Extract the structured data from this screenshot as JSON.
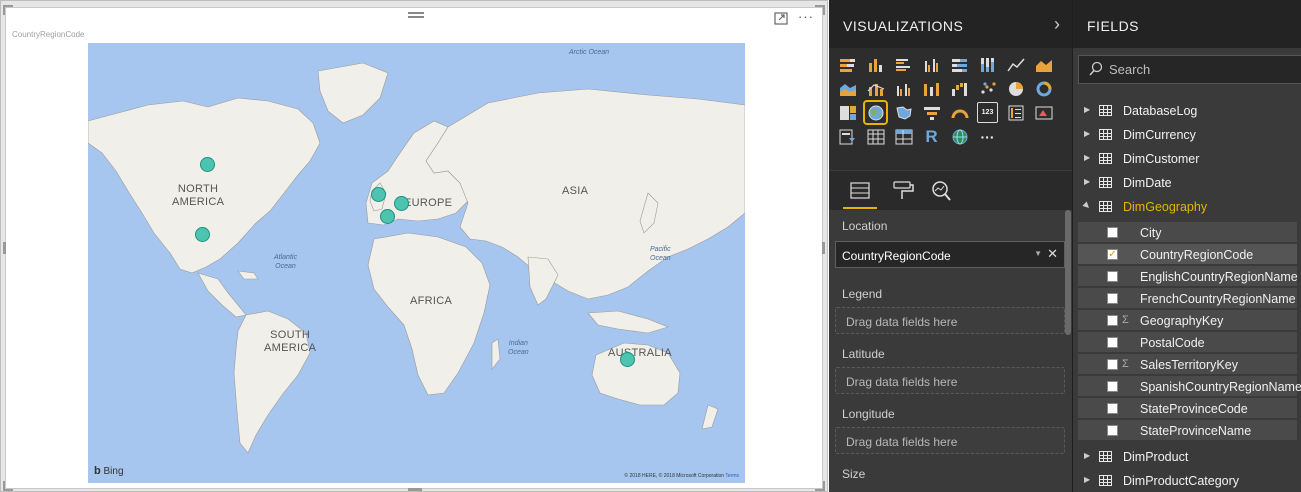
{
  "visual": {
    "title": "CountryRegionCode",
    "focus_icon": "focus-mode-icon",
    "more_icon": "more-options-icon",
    "map": {
      "continents": [
        "NORTH\nAMERICA",
        "SOUTH\nAMERICA",
        "EUROPE",
        "AFRICA",
        "ASIA",
        "AUSTRALIA"
      ],
      "oceans": [
        "Arctic Ocean",
        "Atlantic\nOcean",
        "Pacific\nOcean",
        "Indian\nOcean"
      ],
      "bubbles": [
        "Canada",
        "United States",
        "United Kingdom",
        "Germany",
        "France",
        "Australia"
      ],
      "bing": "Bing",
      "copyright": "© 2018 HERE, © 2018 Microsoft Corporation",
      "terms": "Terms",
      "bubble_color": "#4cc4b0"
    }
  },
  "visualizations": {
    "title": "VISUALIZATIONS",
    "chevron": "›",
    "icons": [
      [
        "stacked-bar",
        "stacked-column",
        "clustered-bar",
        "clustered-column",
        "100-stacked-bar",
        "100-stacked-column",
        "line",
        "area"
      ],
      [
        "stacked-area",
        "line-and-stacked-column",
        "line-and-clustered-column",
        "ribbon",
        "waterfall",
        "scatter",
        "pie",
        "donut"
      ],
      [
        "treemap",
        "map",
        "filled-map",
        "funnel",
        "gauge",
        "card",
        "multi-row-card",
        "kpi"
      ],
      [
        "slicer",
        "table",
        "matrix",
        "r-script",
        "globe",
        "more"
      ]
    ],
    "card_label": "123",
    "r_label": "R",
    "more_label": "···",
    "selected_icon": "map",
    "tabs": [
      "fields-tab",
      "format-tab",
      "analytics-tab"
    ],
    "wells": {
      "location_label": "Location",
      "location_value": "CountryRegionCode",
      "legend_label": "Legend",
      "latitude_label": "Latitude",
      "longitude_label": "Longitude",
      "size_label": "Size",
      "placeholder": "Drag data fields here"
    }
  },
  "fields": {
    "title": "FIELDS",
    "search_placeholder": "Search",
    "tables_before": [
      "DatabaseLog",
      "DimCurrency",
      "DimCustomer",
      "DimDate"
    ],
    "expanded_table": "DimGeography",
    "columns": [
      {
        "name": "City",
        "checked": false,
        "sigma": false
      },
      {
        "name": "CountryRegionCode",
        "checked": true,
        "sigma": false
      },
      {
        "name": "EnglishCountryRegionName",
        "checked": false,
        "sigma": false
      },
      {
        "name": "FrenchCountryRegionName",
        "checked": false,
        "sigma": false
      },
      {
        "name": "GeographyKey",
        "checked": false,
        "sigma": true
      },
      {
        "name": "PostalCode",
        "checked": false,
        "sigma": false
      },
      {
        "name": "SalesTerritoryKey",
        "checked": false,
        "sigma": true
      },
      {
        "name": "SpanishCountryRegionName",
        "checked": false,
        "sigma": false
      },
      {
        "name": "StateProvinceCode",
        "checked": false,
        "sigma": false
      },
      {
        "name": "StateProvinceName",
        "checked": false,
        "sigma": false
      }
    ],
    "tables_after": [
      "DimProduct",
      "DimProductCategory"
    ],
    "accent": "#e8b400"
  }
}
